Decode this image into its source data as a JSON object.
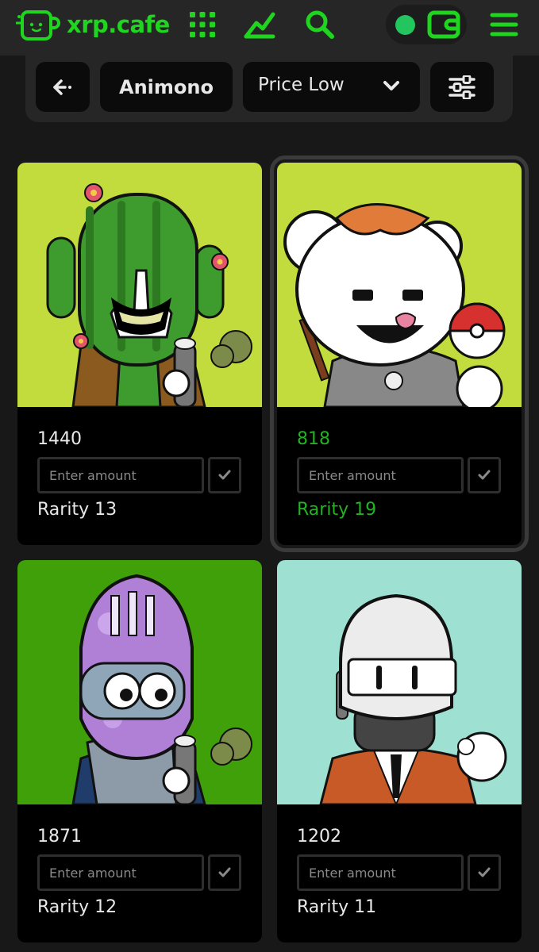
{
  "brand": {
    "name": "xrp.cafe"
  },
  "colors": {
    "accent": "#1fd51f",
    "background": "#181818",
    "status_online": "#22c55e",
    "selected_text": "#24b124"
  },
  "header": {
    "icons": [
      "grid-menu-icon",
      "chart-icon",
      "search-icon",
      "wallet-icon",
      "hamburger-menu-icon"
    ]
  },
  "filters": {
    "collection": "Animono",
    "sort": {
      "selected": "Price Low"
    }
  },
  "cards": [
    {
      "id": "1440",
      "rarity": "Rarity 13",
      "placeholder": "Enter amount",
      "selected": false,
      "bg": "#c1dc3c"
    },
    {
      "id": "818",
      "rarity": "Rarity 19",
      "placeholder": "Enter amount",
      "selected": true,
      "bg": "#c1dc3c"
    },
    {
      "id": "1871",
      "rarity": "Rarity 12",
      "placeholder": "Enter amount",
      "selected": false,
      "bg": "#3fa00a"
    },
    {
      "id": "1202",
      "rarity": "Rarity 11",
      "placeholder": "Enter amount",
      "selected": false,
      "bg": "#9ee0d2"
    }
  ]
}
